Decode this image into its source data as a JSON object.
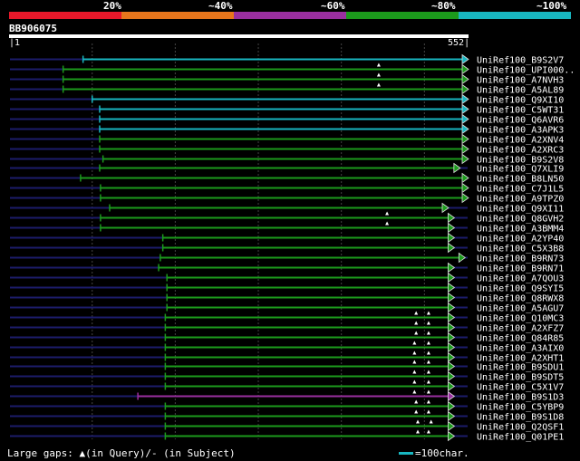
{
  "legend": {
    "segments": [
      {
        "color": "#e8182a"
      },
      {
        "color": "#e8761c"
      },
      {
        "color": "#9a2fa0"
      },
      {
        "color": "#1c9a1c"
      },
      {
        "color": "#18b6c0"
      }
    ],
    "labels": [
      "20%",
      "~40%",
      "~60%",
      "~80%",
      "~100%"
    ]
  },
  "query": {
    "id": "BB906075",
    "start": "1",
    "end": "552"
  },
  "colors": {
    "guide": "#1c1c6a",
    "grid": "#444444",
    "cyan": "#18b6c0",
    "green": "#1c9a1c",
    "purple": "#9a2fa0",
    "gap_marker": "#ffffff"
  },
  "hits": [
    {
      "label": "UniRef100_B9S2V7",
      "start": 89,
      "end": 552,
      "color": "cyan",
      "gaps": []
    },
    {
      "label": "UniRef100_UPI000..",
      "start": 65,
      "end": 552,
      "color": "green",
      "gaps": [
        445
      ]
    },
    {
      "label": "UniRef100_A7NVH3",
      "start": 65,
      "end": 552,
      "color": "green",
      "gaps": [
        445
      ]
    },
    {
      "label": "UniRef100_A5AL89",
      "start": 65,
      "end": 552,
      "color": "green",
      "gaps": [
        445
      ]
    },
    {
      "label": "UniRef100_Q9XI10",
      "start": 100,
      "end": 552,
      "color": "cyan",
      "gaps": []
    },
    {
      "label": "UniRef100_C5WT31",
      "start": 109,
      "end": 552,
      "color": "cyan",
      "gaps": []
    },
    {
      "label": "UniRef100_Q6AVR6",
      "start": 109,
      "end": 552,
      "color": "cyan",
      "gaps": []
    },
    {
      "label": "UniRef100_A3APK3",
      "start": 109,
      "end": 552,
      "color": "cyan",
      "gaps": []
    },
    {
      "label": "UniRef100_A2XNV4",
      "start": 109,
      "end": 552,
      "color": "green",
      "gaps": []
    },
    {
      "label": "UniRef100_A2XRC3",
      "start": 109,
      "end": 552,
      "color": "green",
      "gaps": []
    },
    {
      "label": "UniRef100_B9S2V8",
      "start": 113,
      "end": 552,
      "color": "green",
      "gaps": []
    },
    {
      "label": "UniRef100_Q7XLI9",
      "start": 109,
      "end": 542,
      "color": "green",
      "gaps": []
    },
    {
      "label": "UniRef100_B8LN50",
      "start": 86,
      "end": 552,
      "color": "green",
      "gaps": []
    },
    {
      "label": "UniRef100_C7J1L5",
      "start": 110,
      "end": 552,
      "color": "green",
      "gaps": []
    },
    {
      "label": "UniRef100_A9TPZ0",
      "start": 110,
      "end": 552,
      "color": "green",
      "gaps": []
    },
    {
      "label": "UniRef100_Q9XI11",
      "start": 121,
      "end": 528,
      "color": "green",
      "gaps": []
    },
    {
      "label": "UniRef100_Q8GVH2",
      "start": 110,
      "end": 535,
      "color": "green",
      "gaps": [
        455
      ]
    },
    {
      "label": "UniRef100_A3BMM4",
      "start": 110,
      "end": 535,
      "color": "green",
      "gaps": [
        455
      ]
    },
    {
      "label": "UniRef100_A2YP40",
      "start": 185,
      "end": 535,
      "color": "green",
      "gaps": []
    },
    {
      "label": "UniRef100_C5X3B8",
      "start": 185,
      "end": 535,
      "color": "green",
      "gaps": []
    },
    {
      "label": "UniRef100_B9RN73",
      "start": 182,
      "end": 548,
      "color": "green",
      "gaps": []
    },
    {
      "label": "UniRef100_B9RN71",
      "start": 180,
      "end": 535,
      "color": "green",
      "gaps": []
    },
    {
      "label": "UniRef100_A7QOU3",
      "start": 190,
      "end": 535,
      "color": "green",
      "gaps": []
    },
    {
      "label": "UniRef100_Q9SYI5",
      "start": 190,
      "end": 535,
      "color": "green",
      "gaps": []
    },
    {
      "label": "UniRef100_Q8RWX8",
      "start": 190,
      "end": 535,
      "color": "green",
      "gaps": []
    },
    {
      "label": "UniRef100_A5AGU7",
      "start": 190,
      "end": 535,
      "color": "green",
      "gaps": []
    },
    {
      "label": "UniRef100_Q10MC3",
      "start": 188,
      "end": 535,
      "color": "green",
      "gaps": [
        490,
        505
      ]
    },
    {
      "label": "UniRef100_A2XFZ7",
      "start": 188,
      "end": 535,
      "color": "green",
      "gaps": [
        490,
        505
      ]
    },
    {
      "label": "UniRef100_Q84R85",
      "start": 188,
      "end": 535,
      "color": "green",
      "gaps": [
        490,
        505
      ]
    },
    {
      "label": "UniRef100_A3AIX0",
      "start": 188,
      "end": 535,
      "color": "green",
      "gaps": [
        488,
        505
      ]
    },
    {
      "label": "UniRef100_A2XHT1",
      "start": 188,
      "end": 535,
      "color": "green",
      "gaps": [
        488,
        505
      ]
    },
    {
      "label": "UniRef100_B9SDU1",
      "start": 188,
      "end": 535,
      "color": "green",
      "gaps": [
        488,
        505
      ]
    },
    {
      "label": "UniRef100_B9SDT5",
      "start": 188,
      "end": 535,
      "color": "green",
      "gaps": [
        488,
        505
      ]
    },
    {
      "label": "UniRef100_C5X1V7",
      "start": 188,
      "end": 535,
      "color": "green",
      "gaps": [
        488,
        505
      ]
    },
    {
      "label": "UniRef100_B9S1D3",
      "start": 155,
      "end": 535,
      "color": "purple",
      "gaps": [
        488,
        505
      ]
    },
    {
      "label": "UniRef100_C5YBP9",
      "start": 188,
      "end": 535,
      "color": "green",
      "gaps": [
        490,
        505
      ]
    },
    {
      "label": "UniRef100_B9S1D8",
      "start": 188,
      "end": 535,
      "color": "green",
      "gaps": [
        490,
        505
      ]
    },
    {
      "label": "UniRef100_Q2QSF1",
      "start": 188,
      "end": 535,
      "color": "green",
      "gaps": [
        492,
        508
      ]
    },
    {
      "label": "UniRef100_Q01PE1",
      "start": 188,
      "end": 535,
      "color": "green",
      "gaps": [
        492,
        505
      ]
    }
  ],
  "footer": {
    "gap_legend": "Large gaps: ▲(in Query)/- (in Subject)",
    "scale_legend": "=100char."
  }
}
